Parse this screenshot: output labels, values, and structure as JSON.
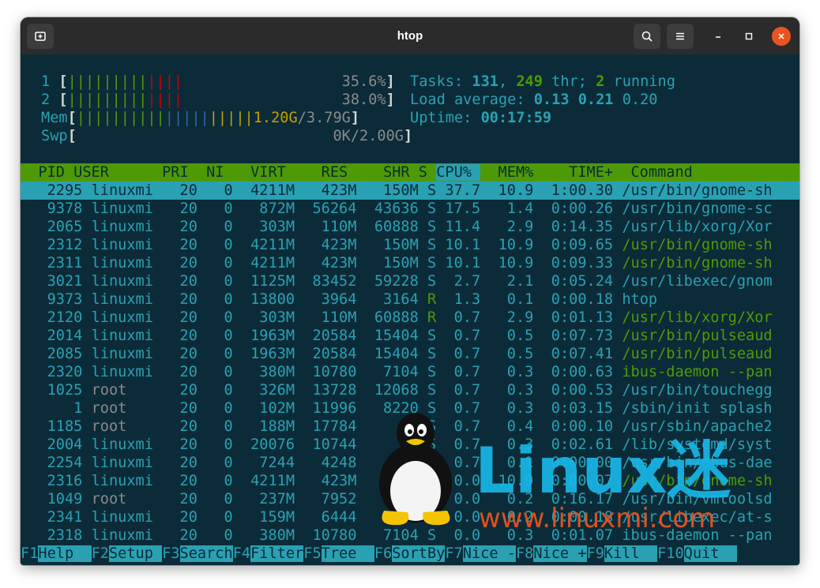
{
  "window": {
    "title": "htop",
    "new_tab_icon": "new-tab-icon",
    "search_icon": "search-icon",
    "menu_icon": "hamburger-menu-icon",
    "minimize_icon": "minimize-icon",
    "maximize_icon": "maximize-icon",
    "close_icon": "close-icon"
  },
  "colors": {
    "background": "#0c2b38",
    "teal": "#2aa1b3",
    "green": "#4e9a06",
    "red": "#cc0000",
    "yellow": "#c4a000",
    "blue": "#3465a4",
    "white": "#d3d7cf",
    "gray": "#8a8a8a",
    "close_button": "#e95420"
  },
  "meters": {
    "cpu1": {
      "label": "1",
      "green_bars": "|||||||||",
      "red_bars": "||||",
      "value": "35.6%"
    },
    "cpu2": {
      "label": "2",
      "green_bars": "|||||||||",
      "red_bars": "||||",
      "value": "38.0%"
    },
    "mem": {
      "label": "Mem",
      "green_bars": "||||||||||",
      "blue_bars": "|||||",
      "yellow_bars": "|||||",
      "used": "1.20G",
      "total": "3.79G"
    },
    "swp": {
      "label": "Swp",
      "value": "0K/2.00G"
    }
  },
  "summary": {
    "tasks_label": "Tasks: ",
    "tasks": "131",
    "threads": "249",
    "thr_label": " thr; ",
    "running": "2",
    "running_label": " running",
    "load_label": "Load average: ",
    "load1": "0.13",
    "load5": "0.21",
    "load15": "0.20",
    "uptime_label": "Uptime: ",
    "uptime": "00:17:59"
  },
  "table": {
    "columns": [
      "PID",
      "USER",
      "PRI",
      "NI",
      "VIRT",
      "RES",
      "SHR",
      "S",
      "CPU%",
      "MEM%",
      "TIME+",
      "Command"
    ],
    "rows": [
      {
        "pid": "2295",
        "user": "linuxmi",
        "pri": "20",
        "ni": "0",
        "virt": "4211M",
        "res": "423M",
        "shr": "150M",
        "s": "S",
        "cpu": "37.7",
        "mem": "10.9",
        "time": "1:00.30",
        "cmd": "/usr/bin/gnome-sh",
        "selected": true
      },
      {
        "pid": "9378",
        "user": "linuxmi",
        "pri": "20",
        "ni": "0",
        "virt": "872M",
        "res": "56264",
        "shr": "43636",
        "s": "S",
        "cpu": "17.5",
        "mem": "1.4",
        "time": "0:00.26",
        "cmd": "/usr/bin/gnome-sc"
      },
      {
        "pid": "2065",
        "user": "linuxmi",
        "pri": "20",
        "ni": "0",
        "virt": "303M",
        "res": "110M",
        "shr": "60888",
        "s": "S",
        "cpu": "11.4",
        "mem": "2.9",
        "time": "0:14.35",
        "cmd": "/usr/lib/xorg/Xor"
      },
      {
        "pid": "2312",
        "user": "linuxmi",
        "pri": "20",
        "ni": "0",
        "virt": "4211M",
        "res": "423M",
        "shr": "150M",
        "s": "S",
        "cpu": "10.1",
        "mem": "10.9",
        "time": "0:09.65",
        "cmd": "/usr/bin/gnome-sh",
        "thread": true
      },
      {
        "pid": "2311",
        "user": "linuxmi",
        "pri": "20",
        "ni": "0",
        "virt": "4211M",
        "res": "423M",
        "shr": "150M",
        "s": "S",
        "cpu": "10.1",
        "mem": "10.9",
        "time": "0:09.33",
        "cmd": "/usr/bin/gnome-sh",
        "thread": true
      },
      {
        "pid": "3021",
        "user": "linuxmi",
        "pri": "20",
        "ni": "0",
        "virt": "1125M",
        "res": "83452",
        "shr": "59228",
        "s": "S",
        "cpu": "2.7",
        "mem": "2.1",
        "time": "0:05.24",
        "cmd": "/usr/libexec/gnom"
      },
      {
        "pid": "9373",
        "user": "linuxmi",
        "pri": "20",
        "ni": "0",
        "virt": "13800",
        "res": "3964",
        "shr": "3164",
        "s": "R",
        "cpu": "1.3",
        "mem": "0.1",
        "time": "0:00.18",
        "cmd": "htop"
      },
      {
        "pid": "2120",
        "user": "linuxmi",
        "pri": "20",
        "ni": "0",
        "virt": "303M",
        "res": "110M",
        "shr": "60888",
        "s": "R",
        "cpu": "0.7",
        "mem": "2.9",
        "time": "0:01.13",
        "cmd": "/usr/lib/xorg/Xor",
        "thread": true
      },
      {
        "pid": "2014",
        "user": "linuxmi",
        "pri": "20",
        "ni": "0",
        "virt": "1963M",
        "res": "20584",
        "shr": "15404",
        "s": "S",
        "cpu": "0.7",
        "mem": "0.5",
        "time": "0:07.73",
        "cmd": "/usr/bin/pulseaud",
        "thread": true
      },
      {
        "pid": "2085",
        "user": "linuxmi",
        "pri": "20",
        "ni": "0",
        "virt": "1963M",
        "res": "20584",
        "shr": "15404",
        "s": "S",
        "cpu": "0.7",
        "mem": "0.5",
        "time": "0:07.41",
        "cmd": "/usr/bin/pulseaud",
        "thread": true
      },
      {
        "pid": "2320",
        "user": "linuxmi",
        "pri": "20",
        "ni": "0",
        "virt": "380M",
        "res": "10780",
        "shr": "7104",
        "s": "S",
        "cpu": "0.7",
        "mem": "0.3",
        "time": "0:00.63",
        "cmd": "ibus-daemon --pan",
        "thread": true
      },
      {
        "pid": "1025",
        "user": "root",
        "pri": "20",
        "ni": "0",
        "virt": "326M",
        "res": "13728",
        "shr": "12068",
        "s": "S",
        "cpu": "0.7",
        "mem": "0.3",
        "time": "0:00.53",
        "cmd": "/usr/bin/touchegg"
      },
      {
        "pid": "1",
        "user": "root",
        "pri": "20",
        "ni": "0",
        "virt": "102M",
        "res": "11996",
        "shr": "8220",
        "s": "S",
        "cpu": "0.7",
        "mem": "0.3",
        "time": "0:03.15",
        "cmd": "/sbin/init splash"
      },
      {
        "pid": "1185",
        "user": "root",
        "pri": "20",
        "ni": "0",
        "virt": "188M",
        "res": "17784",
        "shr": "13",
        "s": "S",
        "cpu": "0.7",
        "mem": "0.4",
        "time": "0:00.10",
        "cmd": "/usr/sbin/apache2"
      },
      {
        "pid": "2004",
        "user": "linuxmi",
        "pri": "20",
        "ni": "0",
        "virt": "20076",
        "res": "10744",
        "shr": "8",
        "s": "S",
        "cpu": "0.7",
        "mem": "0.3",
        "time": "0:02.61",
        "cmd": "/lib/systemd/syst"
      },
      {
        "pid": "2254",
        "user": "linuxmi",
        "pri": "20",
        "ni": "0",
        "virt": "7244",
        "res": "4248",
        "shr": "",
        "s": "S",
        "cpu": "0.7",
        "mem": "0.1",
        "time": "0:00.00",
        "cmd": "/usr/bin/dbus-dae"
      },
      {
        "pid": "2316",
        "user": "linuxmi",
        "pri": "20",
        "ni": "0",
        "virt": "4211M",
        "res": "423M",
        "shr": "",
        "s": "S",
        "cpu": "0.0",
        "mem": "10.9",
        "time": "0:00.07",
        "cmd": "/usr/bin/gnome-sh",
        "thread": true
      },
      {
        "pid": "1049",
        "user": "root",
        "pri": "20",
        "ni": "0",
        "virt": "237M",
        "res": "7952",
        "shr": "",
        "s": "S",
        "cpu": "0.0",
        "mem": "0.2",
        "time": "0:16.17",
        "cmd": "/usr/bin/vmtoolsd"
      },
      {
        "pid": "2341",
        "user": "linuxmi",
        "pri": "20",
        "ni": "0",
        "virt": "159M",
        "res": "6444",
        "shr": "5792",
        "s": "S",
        "cpu": "0.0",
        "mem": "0.2",
        "time": "0:00.18",
        "cmd": "/usr/libexec/at-s"
      },
      {
        "pid": "2318",
        "user": "linuxmi",
        "pri": "20",
        "ni": "0",
        "virt": "380M",
        "res": "10780",
        "shr": "7104",
        "s": "S",
        "cpu": "0.0",
        "mem": "0.3",
        "time": "0:01.07",
        "cmd": "ibus-daemon --pan"
      }
    ]
  },
  "function_keys": [
    {
      "key": "F1",
      "label": "Help  "
    },
    {
      "key": "F2",
      "label": "Setup "
    },
    {
      "key": "F3",
      "label": "Search"
    },
    {
      "key": "F4",
      "label": "Filter"
    },
    {
      "key": "F5",
      "label": "Tree  "
    },
    {
      "key": "F6",
      "label": "SortBy"
    },
    {
      "key": "F7",
      "label": "Nice -"
    },
    {
      "key": "F8",
      "label": "Nice +"
    },
    {
      "key": "F9",
      "label": "Kill  "
    },
    {
      "key": "F10",
      "label": "Quit  "
    }
  ],
  "watermark": {
    "logo_text": "Linux迷",
    "url": "www.linuxmi.com",
    "mascot_icon": "tux-penguin-icon"
  }
}
